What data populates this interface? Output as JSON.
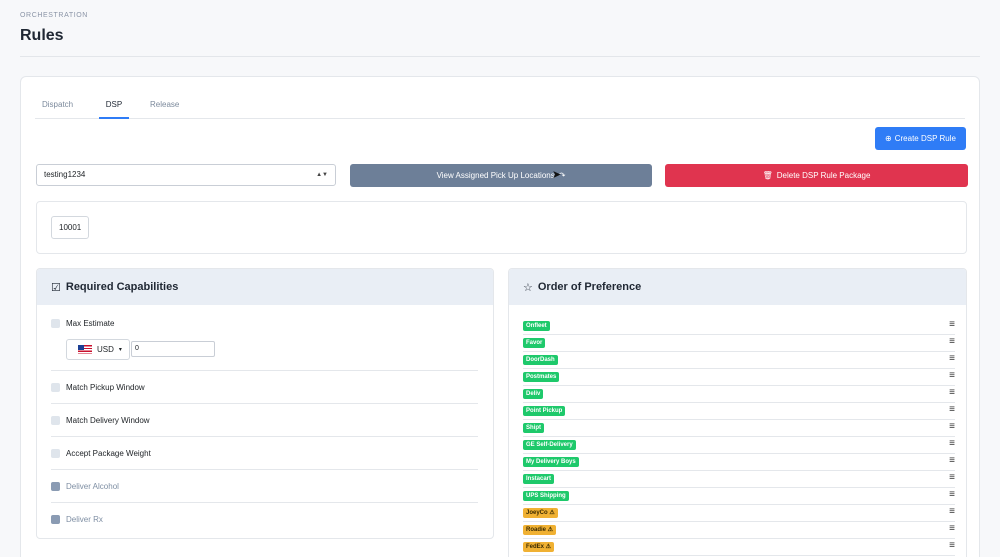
{
  "header": {
    "eyebrow": "ORCHESTRATION",
    "title": "Rules"
  },
  "tabs": [
    {
      "label": "Dispatch"
    },
    {
      "label": "DSP",
      "active": true
    },
    {
      "label": "Release"
    }
  ],
  "actions": {
    "create_label": "Create DSP Rule",
    "view_label": "View Assigned Pick Up Locations",
    "delete_label": "Delete DSP Rule Package"
  },
  "package_select": {
    "value": "testing1234"
  },
  "zip_codes": [
    "10001"
  ],
  "capabilities": {
    "title": "Required Capabilities",
    "max_estimate_label": "Max Estimate",
    "currency": "USD",
    "max_estimate_value": "0",
    "items": [
      {
        "label": "Match Pickup Window",
        "enabled": true
      },
      {
        "label": "Match Delivery Window",
        "enabled": true
      },
      {
        "label": "Accept Package Weight",
        "enabled": true
      },
      {
        "label": "Deliver Alcohol",
        "enabled": false
      },
      {
        "label": "Deliver Rx",
        "enabled": false
      }
    ]
  },
  "preference": {
    "title": "Order of Preference",
    "items": [
      {
        "label": "Onfleet",
        "status": "active"
      },
      {
        "label": "Favor",
        "status": "active"
      },
      {
        "label": "DoorDash",
        "status": "active"
      },
      {
        "label": "Postmates",
        "status": "active"
      },
      {
        "label": "Deliv",
        "status": "active"
      },
      {
        "label": "Point Pickup",
        "status": "active"
      },
      {
        "label": "Shipt",
        "status": "active"
      },
      {
        "label": "GE Self-Delivery",
        "status": "active"
      },
      {
        "label": "My Delivery Boys",
        "status": "active"
      },
      {
        "label": "Instacart",
        "status": "active"
      },
      {
        "label": "UPS Shipping",
        "status": "active"
      },
      {
        "label": "JoeyCo ⚠",
        "status": "warning"
      },
      {
        "label": "Roadie ⚠",
        "status": "warning"
      },
      {
        "label": "FedEx ⚠",
        "status": "warning"
      }
    ]
  },
  "colors": {
    "primary": "#2f7cf6",
    "secondary": "#6d7f98",
    "danger": "#e0344f",
    "badge_active": "#1ec96b",
    "badge_warning": "#f0b133"
  }
}
